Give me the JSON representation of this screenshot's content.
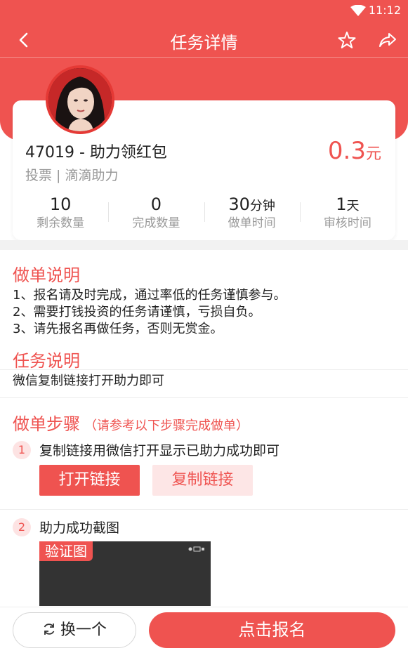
{
  "status_bar": {
    "time": "11:12"
  },
  "nav": {
    "title": "任务详情"
  },
  "task": {
    "title": "47019 - 助力领红包",
    "subtitle": "投票 | 滴滴助力",
    "reward_value": "0.3",
    "reward_unit": "元",
    "stats": [
      {
        "value": "10",
        "unit": "",
        "label": "剩余数量"
      },
      {
        "value": "0",
        "unit": "",
        "label": "完成数量"
      },
      {
        "value": "30",
        "unit": "分钟",
        "label": "做单时间"
      },
      {
        "value": "1",
        "unit": "天",
        "label": "审核时间"
      }
    ]
  },
  "instructions": {
    "title": "做单说明",
    "lines": [
      "1、报名请及时完成，通过率低的任务谨慎参与。",
      "2、需要打钱投资的任务请谨慎，亏损自负。",
      "3、请先报名再做任务，否则无赏金。"
    ]
  },
  "description": {
    "title": "任务说明",
    "text": "微信复制链接打开助力即可"
  },
  "steps": {
    "title": "做单步骤",
    "hint": "（请参考以下步骤完成做单）",
    "items": [
      {
        "num": "1",
        "text": "复制链接用微信打开显示已助力成功即可"
      },
      {
        "num": "2",
        "text": "助力成功截图"
      }
    ],
    "open_link_label": "打开链接",
    "copy_link_label": "复制链接",
    "proof_tag": "验证图"
  },
  "bottom": {
    "switch_label": "换一个",
    "signup_label": "点击报名"
  },
  "colors": {
    "accent": "#ef5350",
    "accent_light": "#fde6e6"
  }
}
